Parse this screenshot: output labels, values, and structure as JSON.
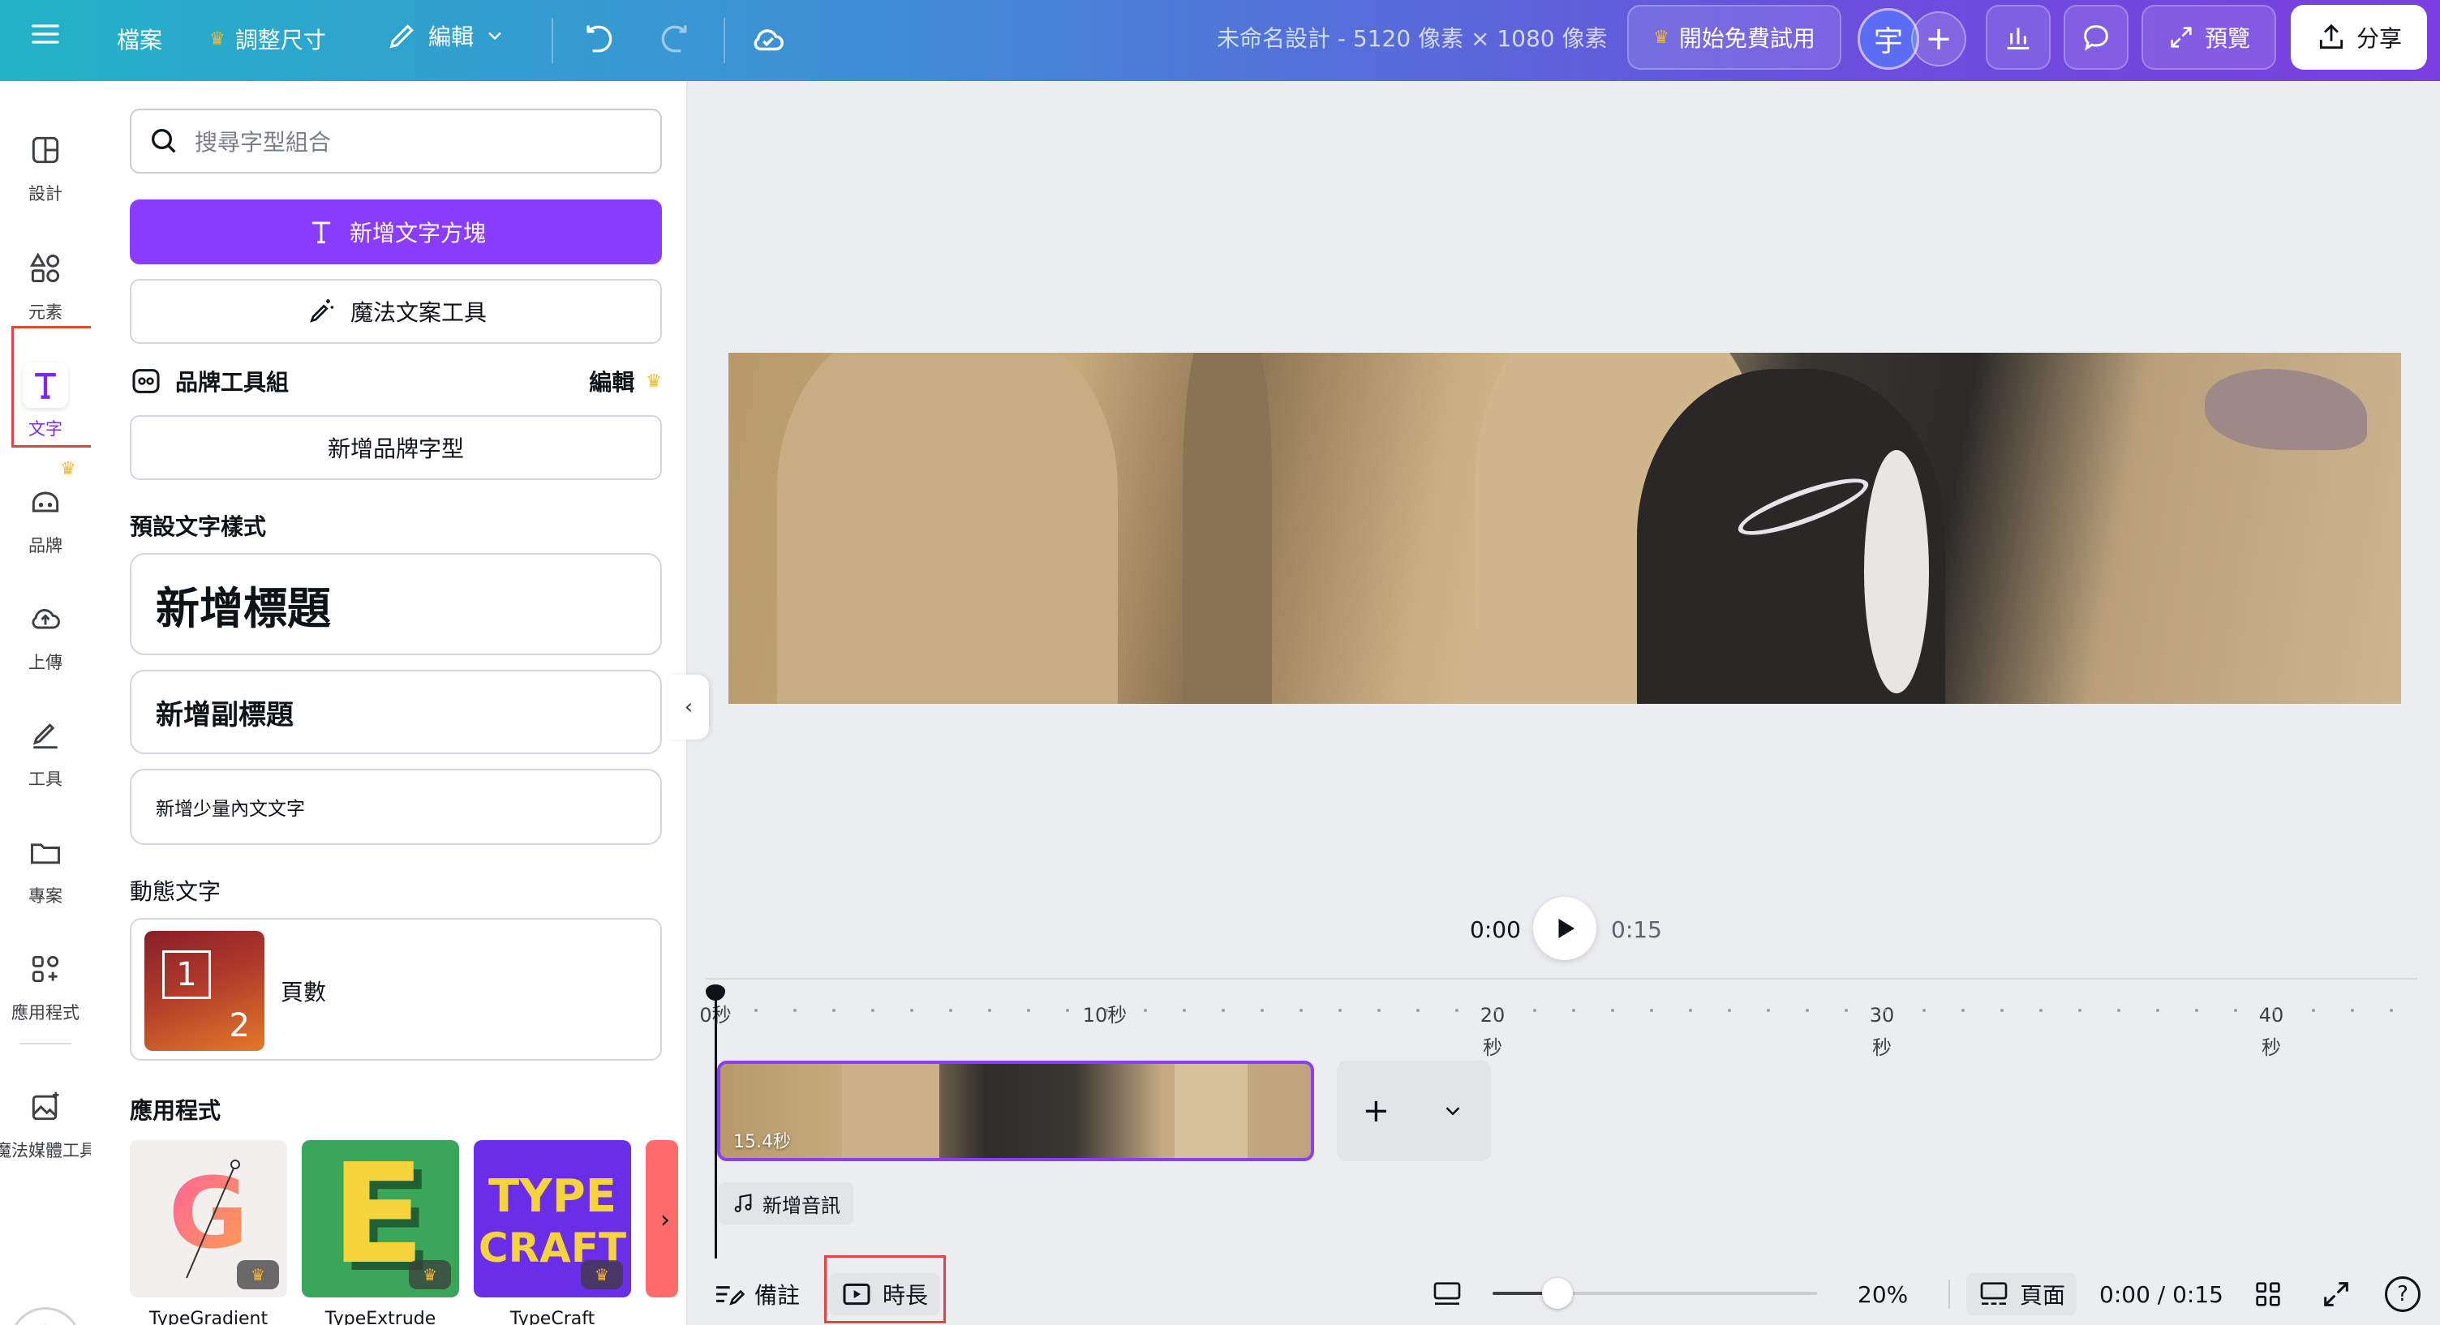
{
  "topbar": {
    "file_label": "檔案",
    "resize_label": "調整尺寸",
    "edit_label": "編輯",
    "doc_title": "未命名設計 - 5120 像素 × 1080 像素",
    "trial_label": "開始免費試用",
    "avatar_initial": "宇",
    "preview_label": "預覽",
    "share_label": "分享"
  },
  "rail": {
    "items": [
      {
        "label": "設計",
        "icon": "layout-icon"
      },
      {
        "label": "元素",
        "icon": "shapes-icon"
      },
      {
        "label": "文字",
        "icon": "text-icon"
      },
      {
        "label": "品牌",
        "icon": "brand-icon"
      },
      {
        "label": "上傳",
        "icon": "cloud-upload-icon"
      },
      {
        "label": "工具",
        "icon": "pen-icon"
      },
      {
        "label": "專案",
        "icon": "folder-icon"
      },
      {
        "label": "應用程式",
        "icon": "apps-icon"
      },
      {
        "label": "魔法媒體工具",
        "icon": "magic-image-icon"
      }
    ],
    "active": "文字"
  },
  "panel": {
    "search_placeholder": "搜尋字型組合",
    "add_text_box": "新增文字方塊",
    "magic_write": "魔法文案工具",
    "brand_kit": "品牌工具組",
    "brand_edit": "編輯",
    "add_brand_font": "新增品牌字型",
    "default_styles_title": "預設文字樣式",
    "add_heading": "新增標題",
    "add_subheading": "新增副標題",
    "add_body": "新增少量內文文字",
    "dynamic_title": "動態文字",
    "page_number": "頁數",
    "dyn_thumb_num1": "1",
    "dyn_thumb_num2": "2",
    "apps_title": "應用程式",
    "apps": [
      {
        "name": "TypeGradient",
        "tile_text": "G",
        "bg": "#f2f0ee"
      },
      {
        "name": "TypeExtrude",
        "tile_text": "E",
        "bg": "#3aa65a"
      },
      {
        "name": "TypeCraft",
        "tile_text": "TYPE CRAFT",
        "bg": "#6a2ee8"
      }
    ]
  },
  "playback": {
    "current": "0:00",
    "total": "0:15"
  },
  "timeline": {
    "ticks": [
      "0秒",
      "10秒",
      "20秒",
      "30秒",
      "40秒"
    ],
    "clip_duration": "15.4秒",
    "add_audio": "新增音訊"
  },
  "bottombar": {
    "notes": "備註",
    "duration": "時長",
    "zoom": "20%",
    "zoom_fraction": 0.2,
    "pages": "頁面",
    "time": "0:00 / 0:15",
    "help": "?"
  },
  "colors": {
    "accent": "#8b3dff",
    "highlight_box": "#e0463b",
    "crown": "#f7b731"
  }
}
